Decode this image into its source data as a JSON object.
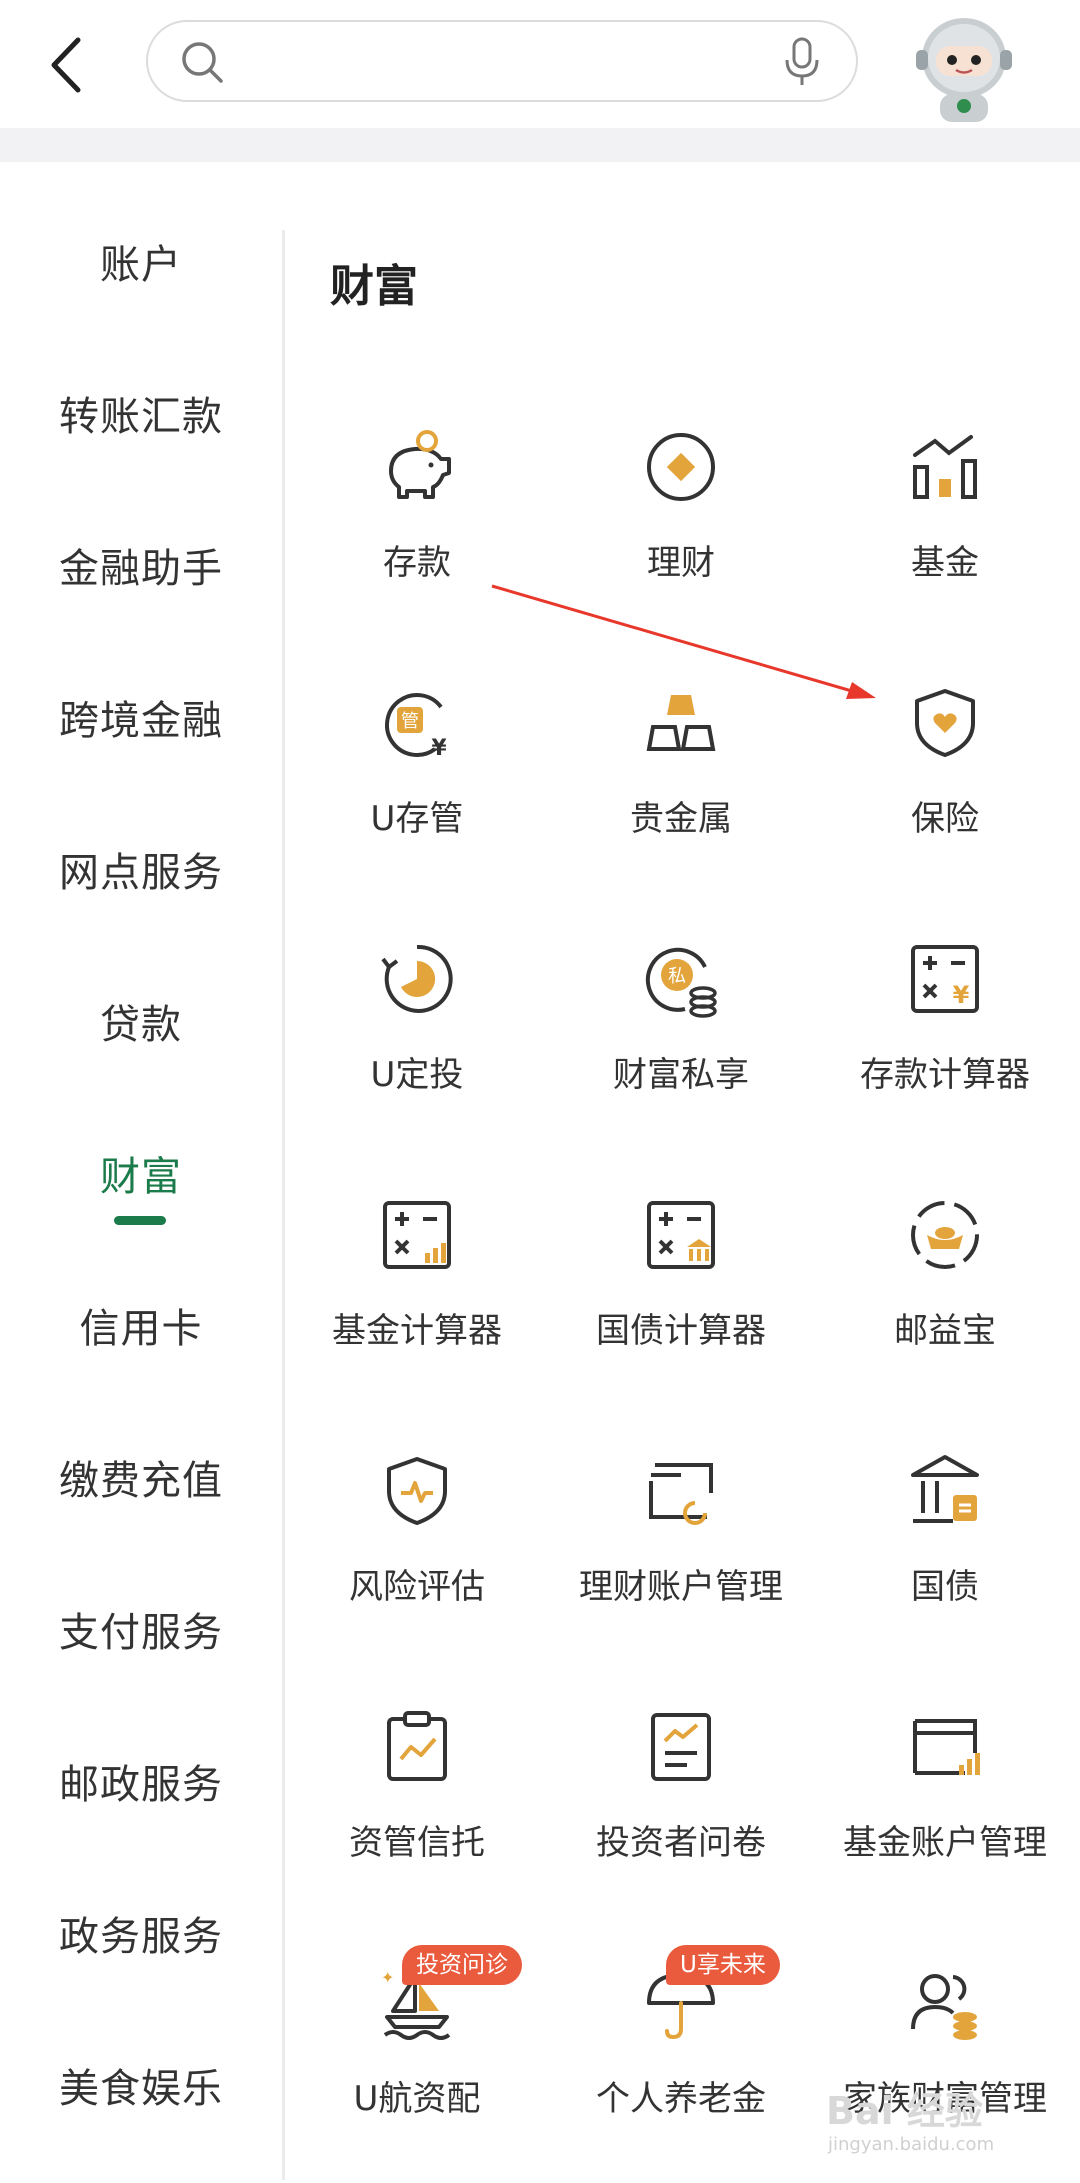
{
  "header": {
    "search": {
      "value": "",
      "placeholder": ""
    },
    "icons": {
      "back": "chevron-left-icon",
      "search": "search-icon",
      "mic": "microphone-icon",
      "avatar": "robot-avatar"
    }
  },
  "sidebar": {
    "items": [
      {
        "label": "账户"
      },
      {
        "label": "转账汇款"
      },
      {
        "label": "金融助手"
      },
      {
        "label": "跨境金融"
      },
      {
        "label": "网点服务"
      },
      {
        "label": "贷款"
      },
      {
        "label": "财富",
        "active": true
      },
      {
        "label": "信用卡"
      },
      {
        "label": "缴费充值"
      },
      {
        "label": "支付服务"
      },
      {
        "label": "邮政服务"
      },
      {
        "label": "政务服务"
      },
      {
        "label": "美食娱乐"
      }
    ]
  },
  "main": {
    "title": "财富",
    "tiles": [
      {
        "label": "存款",
        "icon": "piggy-bank-icon"
      },
      {
        "label": "理财",
        "icon": "diamond-coin-icon"
      },
      {
        "label": "基金",
        "icon": "bar-chart-icon"
      },
      {
        "label": "U存管",
        "icon": "custody-icon"
      },
      {
        "label": "贵金属",
        "icon": "gold-bars-icon"
      },
      {
        "label": "保险",
        "icon": "shield-heart-icon"
      },
      {
        "label": "U定投",
        "icon": "pie-cycle-icon"
      },
      {
        "label": "财富私享",
        "icon": "private-wealth-icon"
      },
      {
        "label": "存款计算器",
        "icon": "calculator-yen-icon"
      },
      {
        "label": "基金计算器",
        "icon": "calculator-chart-icon"
      },
      {
        "label": "国债计算器",
        "icon": "calculator-bank-icon"
      },
      {
        "label": "邮益宝",
        "icon": "ingot-cycle-icon"
      },
      {
        "label": "风险评估",
        "icon": "shield-pulse-icon"
      },
      {
        "label": "理财账户管理",
        "icon": "card-account-icon"
      },
      {
        "label": "国债",
        "icon": "bank-building-icon"
      },
      {
        "label": "资管信托",
        "icon": "clipboard-trend-icon"
      },
      {
        "label": "投资者问卷",
        "icon": "document-trend-icon"
      },
      {
        "label": "基金账户管理",
        "icon": "card-chart-icon"
      },
      {
        "label": "U航资配",
        "icon": "sailboat-icon",
        "badge": "投资问诊"
      },
      {
        "label": "个人养老金",
        "icon": "umbrella-icon",
        "badge": "U享未来"
      },
      {
        "label": "家族财富管理",
        "icon": "family-coins-icon"
      }
    ]
  },
  "watermark": {
    "text": "Bai 经验",
    "sub": "jingyan.baidu.com"
  },
  "colors": {
    "accent": "#1c7b4a",
    "icon_orange": "#e3a43c",
    "icon_dark": "#333333",
    "badge": "#ea5a3d",
    "arrow": "#e8372b"
  }
}
